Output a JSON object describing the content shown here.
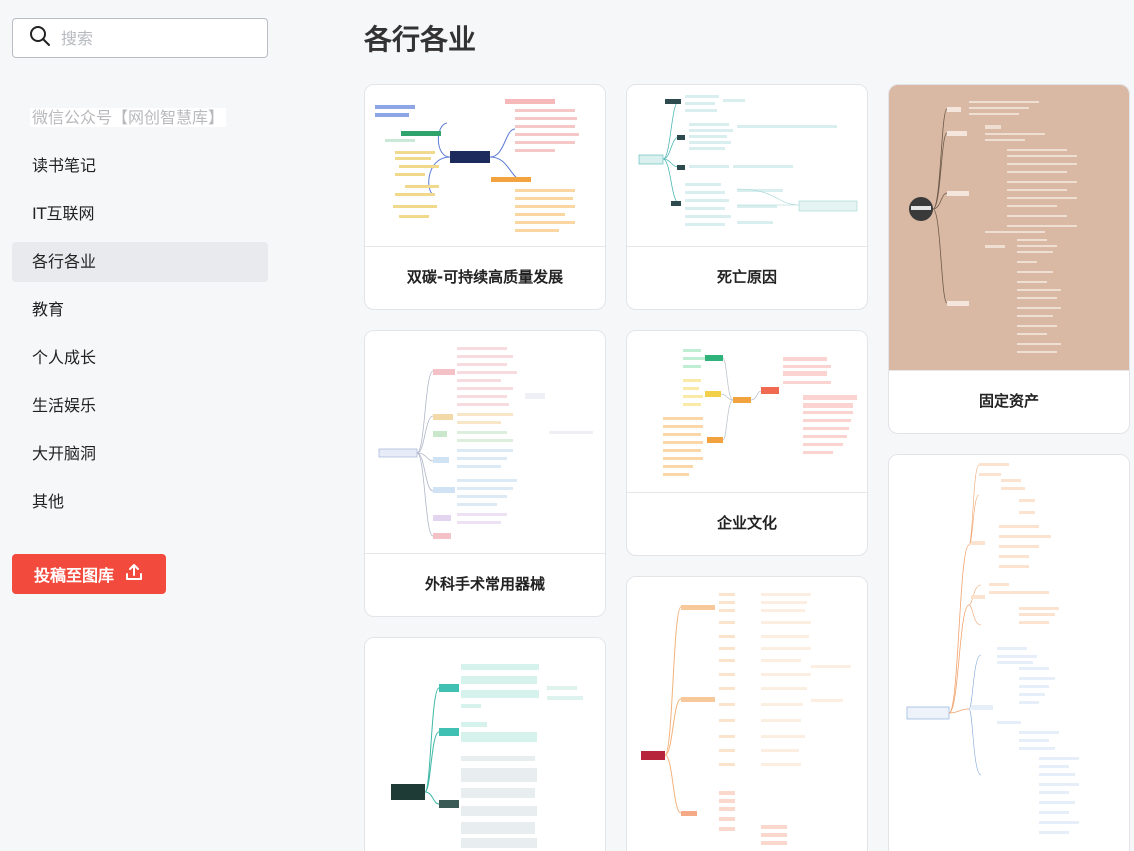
{
  "search": {
    "placeholder": "搜索"
  },
  "sidebar": {
    "items": [
      {
        "label": "微信公众号【网创智慧库】",
        "kind": "promo"
      },
      {
        "label": "读书笔记"
      },
      {
        "label": "IT互联网"
      },
      {
        "label": "各行各业",
        "active": true
      },
      {
        "label": "教育"
      },
      {
        "label": "个人成长"
      },
      {
        "label": "生活娱乐"
      },
      {
        "label": "大开脑洞"
      },
      {
        "label": "其他"
      }
    ],
    "upload_label": "投稿至图库"
  },
  "main": {
    "title": "各行各业",
    "cards": [
      {
        "title": "双碳-可持续高质量发展"
      },
      {
        "title": "死亡原因"
      },
      {
        "title": "固定资产"
      },
      {
        "title": "外科手术常用器械"
      },
      {
        "title": "企业文化"
      },
      {
        "title": ""
      },
      {
        "title": ""
      },
      {
        "title": ""
      }
    ]
  },
  "colors": {
    "accent": "#f24a3d",
    "active_bg": "#e9eaed",
    "brown_bg": "#d9b9a3"
  }
}
